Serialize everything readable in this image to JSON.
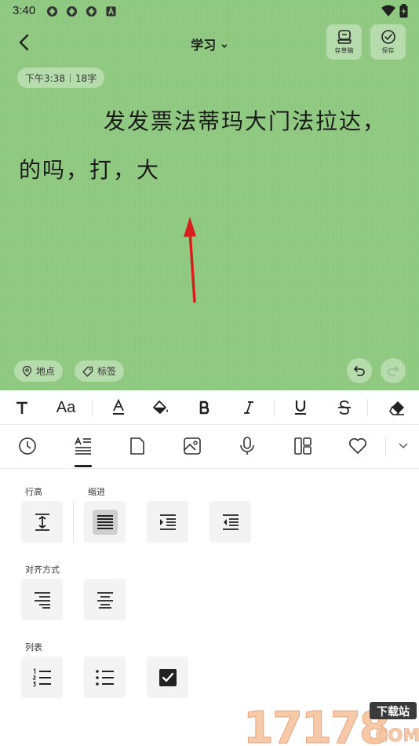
{
  "status_bar": {
    "time": "3:40"
  },
  "header": {
    "title": "学习",
    "draft_label": "存草稿",
    "save_label": "保存"
  },
  "meta": {
    "time": "下午3:38",
    "count": "18字"
  },
  "note": {
    "text": "发发票法蒂玛大门法拉达，的吗，打，大"
  },
  "chips": {
    "location": "地点",
    "tag": "标签"
  },
  "format_bar": {
    "font_size_glyph": "Aa"
  },
  "panel": {
    "line_height_label": "行高",
    "indent_label": "缩进",
    "align_label": "对齐方式",
    "list_label": "列表"
  },
  "watermark": {
    "number": "17178",
    "badge": "下载站",
    "domain": ".COM"
  },
  "colors": {
    "editor_bg": "#8fca80",
    "arrow": "#d81e1e"
  }
}
